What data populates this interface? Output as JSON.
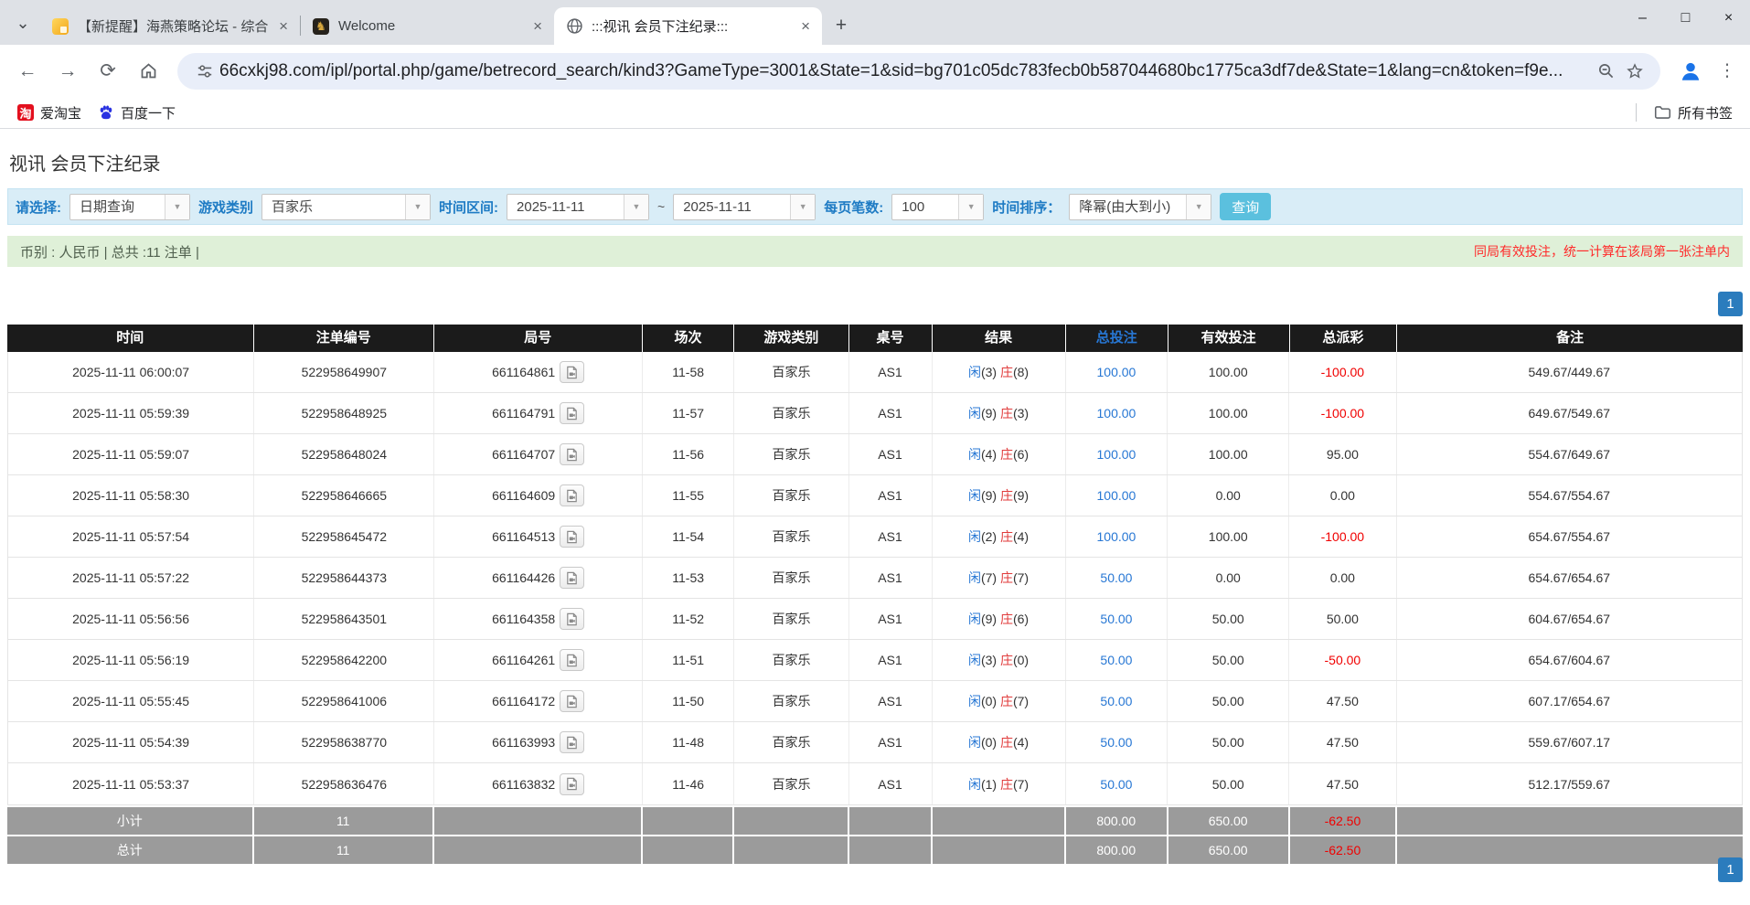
{
  "browser": {
    "tabs": [
      {
        "title": "【新提醒】海燕策略论坛 - 综合",
        "close": "×"
      },
      {
        "title": "Welcome",
        "close": "×"
      },
      {
        "title": ":::视讯 会员下注纪录:::",
        "close": "×"
      }
    ],
    "tab2_emblem": "♞",
    "url": "66cxkj98.com/ipl/portal.php/game/betrecord_search/kind3?GameType=3001&State=1&sid=bg701c05dc783fecb0b587044680bc1775ca3df7de&State=1&lang=cn&token=f9e...",
    "bookmarks": {
      "taobao_icon_glyph": "淘",
      "taobao": "爱淘宝",
      "baidu": "百度一下",
      "all_bookmarks": "所有书签"
    },
    "icons": {
      "tab_search": "⌄",
      "new_tab": "+",
      "minimize": "–",
      "maximize": "□",
      "window_close": "×",
      "back": "←",
      "forward": "→",
      "reload": "⟳",
      "menu_dots": "⋮",
      "dropdown_arrow": "▼"
    }
  },
  "page": {
    "title": "视讯 会员下注纪录",
    "filters": {
      "select_label": "请选择:",
      "select_value": "日期查询",
      "game_type_label": "游戏类别",
      "game_type_value": "百家乐",
      "date_range_label": "时间区间:",
      "date_from": "2025-11-11",
      "tilde": "~",
      "date_to": "2025-11-11",
      "page_size_label": "每页笔数:",
      "page_size_value": "100",
      "sort_label": "时间排序：",
      "sort_value": "降幂(由大到小)",
      "search_button": "查询"
    },
    "info_bar": {
      "left": "币别 : 人民币 | 总共 :11 注单 |",
      "right": "同局有效投注，统一计算在该局第一张注单内"
    },
    "pagination": "1",
    "table": {
      "headers": [
        "时间",
        "注单编号",
        "局号",
        "场次",
        "游戏类别",
        "桌号",
        "结果",
        "总投注",
        "有效投注",
        "总派彩",
        "备注"
      ],
      "rows": [
        {
          "time": "2025-11-11 06:00:07",
          "bet_id": "522958649907",
          "round_id": "661164861",
          "session": "11-58",
          "game": "百家乐",
          "table_id": "AS1",
          "result": {
            "p_label": "闲",
            "p_num": "(3)",
            "b_label": "庄",
            "b_num": "(8)"
          },
          "total_bet": "100.00",
          "valid_bet": "100.00",
          "payout": "-100.00",
          "remark": "549.67/449.67"
        },
        {
          "time": "2025-11-11 05:59:39",
          "bet_id": "522958648925",
          "round_id": "661164791",
          "session": "11-57",
          "game": "百家乐",
          "table_id": "AS1",
          "result": {
            "p_label": "闲",
            "p_num": "(9)",
            "b_label": "庄",
            "b_num": "(3)"
          },
          "total_bet": "100.00",
          "valid_bet": "100.00",
          "payout": "-100.00",
          "remark": "649.67/549.67"
        },
        {
          "time": "2025-11-11 05:59:07",
          "bet_id": "522958648024",
          "round_id": "661164707",
          "session": "11-56",
          "game": "百家乐",
          "table_id": "AS1",
          "result": {
            "p_label": "闲",
            "p_num": "(4)",
            "b_label": "庄",
            "b_num": "(6)"
          },
          "total_bet": "100.00",
          "valid_bet": "100.00",
          "payout": "95.00",
          "remark": "554.67/649.67"
        },
        {
          "time": "2025-11-11 05:58:30",
          "bet_id": "522958646665",
          "round_id": "661164609",
          "session": "11-55",
          "game": "百家乐",
          "table_id": "AS1",
          "result": {
            "p_label": "闲",
            "p_num": "(9)",
            "b_label": "庄",
            "b_num": "(9)"
          },
          "total_bet": "100.00",
          "valid_bet": "0.00",
          "payout": "0.00",
          "remark": "554.67/554.67"
        },
        {
          "time": "2025-11-11 05:57:54",
          "bet_id": "522958645472",
          "round_id": "661164513",
          "session": "11-54",
          "game": "百家乐",
          "table_id": "AS1",
          "result": {
            "p_label": "闲",
            "p_num": "(2)",
            "b_label": "庄",
            "b_num": "(4)"
          },
          "total_bet": "100.00",
          "valid_bet": "100.00",
          "payout": "-100.00",
          "remark": "654.67/554.67"
        },
        {
          "time": "2025-11-11 05:57:22",
          "bet_id": "522958644373",
          "round_id": "661164426",
          "session": "11-53",
          "game": "百家乐",
          "table_id": "AS1",
          "result": {
            "p_label": "闲",
            "p_num": "(7)",
            "b_label": "庄",
            "b_num": "(7)"
          },
          "total_bet": "50.00",
          "valid_bet": "0.00",
          "payout": "0.00",
          "remark": "654.67/654.67"
        },
        {
          "time": "2025-11-11 05:56:56",
          "bet_id": "522958643501",
          "round_id": "661164358",
          "session": "11-52",
          "game": "百家乐",
          "table_id": "AS1",
          "result": {
            "p_label": "闲",
            "p_num": "(9)",
            "b_label": "庄",
            "b_num": "(6)"
          },
          "total_bet": "50.00",
          "valid_bet": "50.00",
          "payout": "50.00",
          "remark": "604.67/654.67"
        },
        {
          "time": "2025-11-11 05:56:19",
          "bet_id": "522958642200",
          "round_id": "661164261",
          "session": "11-51",
          "game": "百家乐",
          "table_id": "AS1",
          "result": {
            "p_label": "闲",
            "p_num": "(3)",
            "b_label": "庄",
            "b_num": "(0)"
          },
          "total_bet": "50.00",
          "valid_bet": "50.00",
          "payout": "-50.00",
          "remark": "654.67/604.67"
        },
        {
          "time": "2025-11-11 05:55:45",
          "bet_id": "522958641006",
          "round_id": "661164172",
          "session": "11-50",
          "game": "百家乐",
          "table_id": "AS1",
          "result": {
            "p_label": "闲",
            "p_num": "(0)",
            "b_label": "庄",
            "b_num": "(7)"
          },
          "total_bet": "50.00",
          "valid_bet": "50.00",
          "payout": "47.50",
          "remark": "607.17/654.67"
        },
        {
          "time": "2025-11-11 05:54:39",
          "bet_id": "522958638770",
          "round_id": "661163993",
          "session": "11-48",
          "game": "百家乐",
          "table_id": "AS1",
          "result": {
            "p_label": "闲",
            "p_num": "(0)",
            "b_label": "庄",
            "b_num": "(4)"
          },
          "total_bet": "50.00",
          "valid_bet": "50.00",
          "payout": "47.50",
          "remark": "559.67/607.17"
        },
        {
          "time": "2025-11-11 05:53:37",
          "bet_id": "522958636476",
          "round_id": "661163832",
          "session": "11-46",
          "game": "百家乐",
          "table_id": "AS1",
          "result": {
            "p_label": "闲",
            "p_num": "(1)",
            "b_label": "庄",
            "b_num": "(7)"
          },
          "total_bet": "50.00",
          "valid_bet": "50.00",
          "payout": "47.50",
          "remark": "512.17/559.67"
        }
      ],
      "subtotal": {
        "label": "小计",
        "count": "11",
        "total_bet": "800.00",
        "valid_bet": "650.00",
        "payout": "-62.50"
      },
      "total": {
        "label": "总计",
        "count": "11",
        "total_bet": "800.00",
        "valid_bet": "650.00",
        "payout": "-62.50"
      }
    }
  }
}
